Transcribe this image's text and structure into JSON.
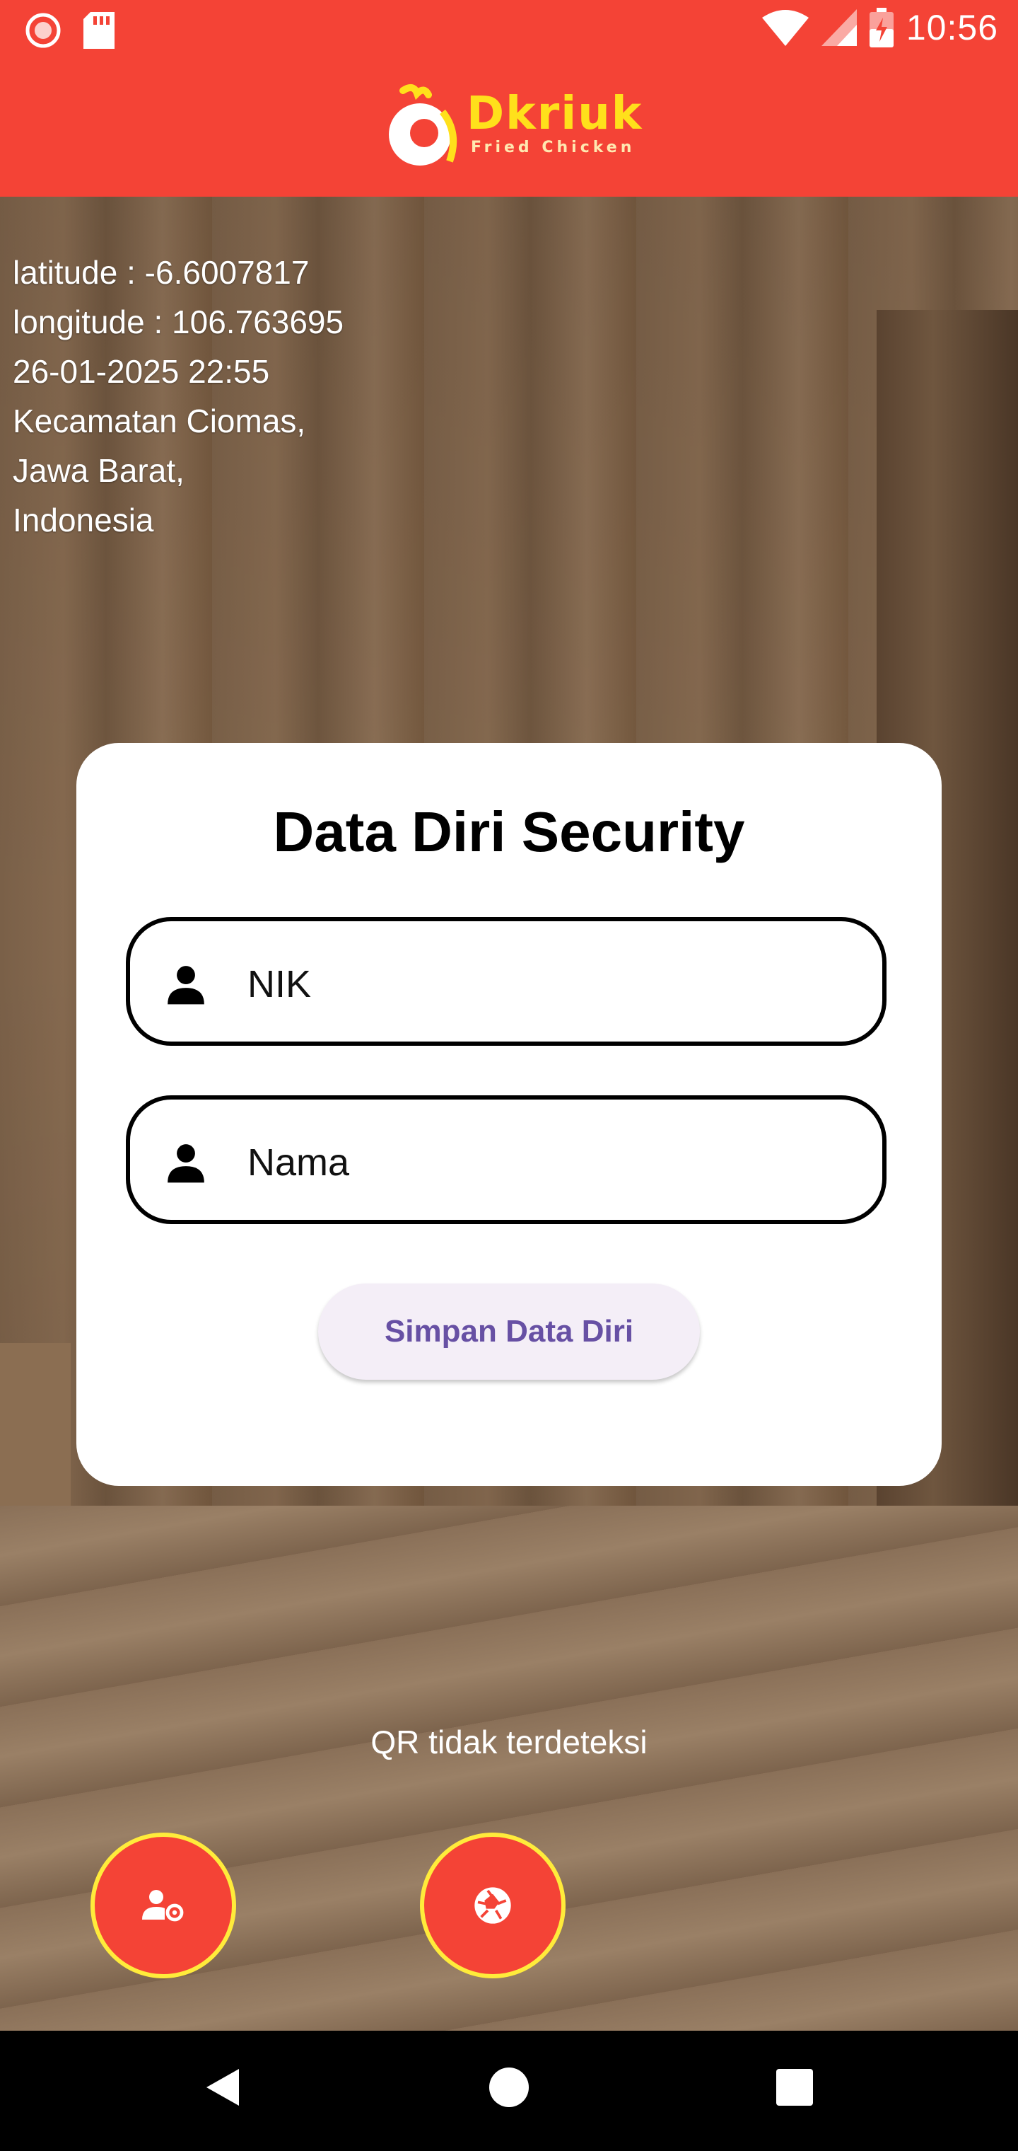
{
  "status_bar": {
    "time": "10:56",
    "left_icons": [
      "record-icon",
      "sd-card-icon"
    ],
    "right_icons": [
      "wifi-icon",
      "signal-icon",
      "battery-charging-icon"
    ]
  },
  "app_bar": {
    "logo_text": "Dkriuk",
    "logo_subtitle": "Fried Chicken",
    "background_color": "#F44336",
    "logo_color": "#FFE01B"
  },
  "location": {
    "latitude": "latitude : -6.6007817",
    "longitude": "longitude : 106.763695",
    "datetime": "26-01-2025 22:55",
    "district": "Kecamatan Ciomas,",
    "province": "Jawa Barat,",
    "country": "Indonesia"
  },
  "form": {
    "title": "Data Diri Security",
    "nik_placeholder": "NIK",
    "name_placeholder": "Nama",
    "save_label": "Simpan Data Diri",
    "field_icon": "person-icon",
    "button_text_color": "#6750A4"
  },
  "qr_status": "QR tidak terdeteksi",
  "fabs": [
    {
      "icon": "user-settings-icon",
      "color": "#F44336",
      "border": "#FFEB3B"
    },
    {
      "icon": "camera-shutter-icon",
      "color": "#F44336",
      "border": "#FFEB3B"
    }
  ],
  "nav_bar": {
    "buttons": [
      "back-icon",
      "home-icon",
      "recents-icon"
    ]
  }
}
